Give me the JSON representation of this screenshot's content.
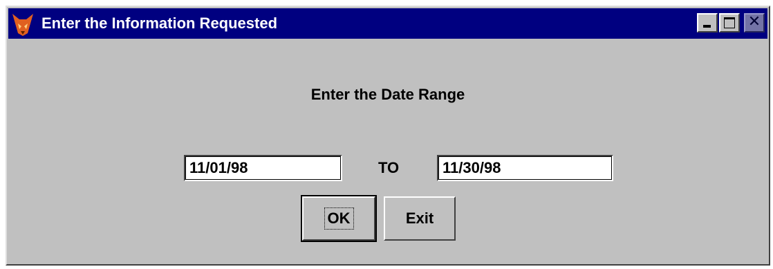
{
  "window": {
    "title": "Enter the Information Requested",
    "icon": "foxpro-fox-icon",
    "controls": [
      "minimize",
      "maximize",
      "close"
    ]
  },
  "form": {
    "heading": "Enter the Date Range",
    "start_date": "11/01/98",
    "separator": "TO",
    "end_date": "11/30/98"
  },
  "buttons": {
    "ok_label": "OK",
    "exit_label": "Exit"
  },
  "colors": {
    "titlebar": "#000080",
    "face": "#c0c0c0"
  }
}
